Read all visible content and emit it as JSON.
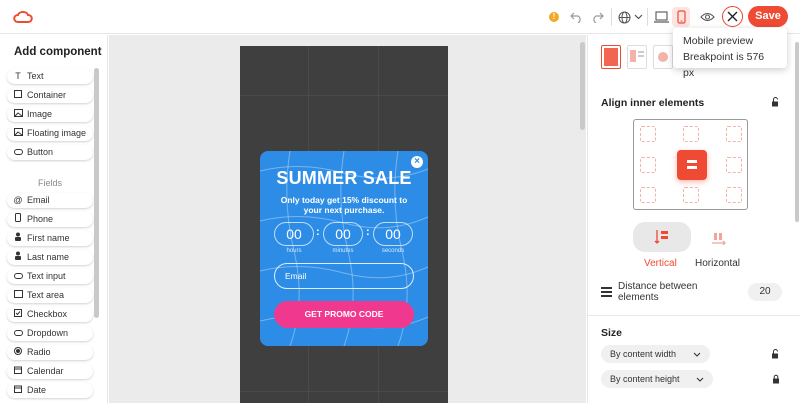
{
  "topbar": {
    "warning_icon": "!",
    "save_label": "Save",
    "icons": [
      "logo-icon",
      "warning-icon",
      "undo-icon",
      "redo-icon",
      "globe-icon",
      "chevron-down-icon",
      "desktop-icon",
      "mobile-icon",
      "eye-icon",
      "close-icon"
    ]
  },
  "tooltip": {
    "line1": "Mobile preview",
    "line2": "Breakpoint is 576 px"
  },
  "left_panel": {
    "title": "Add component",
    "components": [
      "Text",
      "Container",
      "Image",
      "Floating image",
      "Button"
    ],
    "fields_label": "Fields",
    "fields": [
      "Email",
      "Phone",
      "First name",
      "Last name",
      "Text input",
      "Text area",
      "Checkbox",
      "Dropdown",
      "Radio",
      "Calendar",
      "Date"
    ]
  },
  "popup": {
    "title": "SUMMER SALE",
    "subtitle": "Only today get 15% discount to your next purchase.",
    "countdown": [
      {
        "value": "00",
        "label": "hours"
      },
      {
        "value": "00",
        "label": "minutes"
      },
      {
        "value": "00",
        "label": "seconds"
      }
    ],
    "colon": ":",
    "email_placeholder": "Email",
    "cta": "GET PROMO CODE",
    "colors": {
      "background": "#2d8de6",
      "cta": "#f0388e"
    }
  },
  "right_panel": {
    "align_title": "Align inner elements",
    "vertical_label": "Vertical",
    "horizontal_label": "Horizontal",
    "distance_label": "Distance between elements",
    "distance_value": "20",
    "size_title": "Size",
    "width_option": "By content width",
    "height_option": "By content height"
  },
  "accent_color": "#ef4a33"
}
